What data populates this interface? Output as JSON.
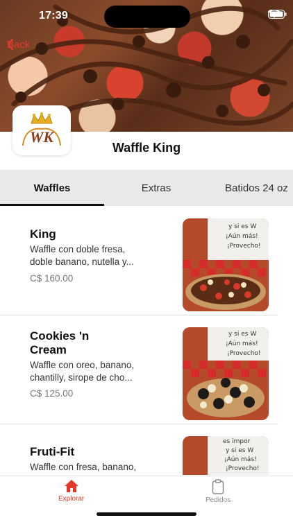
{
  "status_bar": {
    "time": "17:39"
  },
  "header": {
    "back_label": "Back"
  },
  "restaurant": {
    "name": "Waffle King",
    "logo_text": "WK"
  },
  "tabs": [
    {
      "label": "Waffles",
      "active": true
    },
    {
      "label": "Extras",
      "active": false
    },
    {
      "label": "Batidos 24 oz",
      "active": false
    }
  ],
  "menu": [
    {
      "name": "King",
      "description_line1": "Waffle con doble fresa,",
      "description_line2": "doble banano, nutella y...",
      "price": "C$ 160.00"
    },
    {
      "name_line1": "Cookies 'n",
      "name_line2": "Cream",
      "description_line1": "Waffle con oreo, banano,",
      "description_line2": "chantilly, sirope de cho...",
      "price": "C$ 125.00"
    },
    {
      "name": "Fruti-Fit",
      "description_line1": "Waffle con fresa, banano,"
    }
  ],
  "thumb_sign": {
    "line1": "y si es W",
    "line2": "¡Aún más!",
    "line3": "¡Provecho!",
    "line0": "es impor"
  },
  "bottom_nav": {
    "explore": "Explorar",
    "orders": "Pedidos"
  },
  "colors": {
    "accent": "#e0382a",
    "tab_bar": "#e9e9ea",
    "price": "#777777"
  }
}
